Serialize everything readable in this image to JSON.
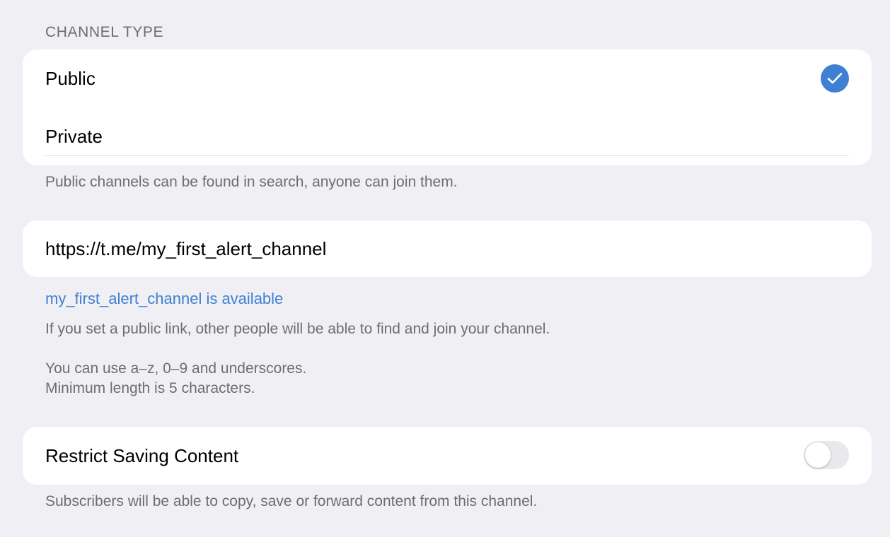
{
  "channel_type": {
    "header": "CHANNEL TYPE",
    "options": [
      {
        "label": "Public",
        "selected": true
      },
      {
        "label": "Private",
        "selected": false
      }
    ],
    "footer": "Public channels can be found in search, anyone can join them."
  },
  "link": {
    "value": "https://t.me/my_first_alert_channel",
    "availability": "my_first_alert_channel is available",
    "footer_line1": "If you set a public link, other people will be able to find and join your channel.",
    "footer_line2": "You can use a–z, 0–9 and underscores.",
    "footer_line3": "Minimum length is 5 characters."
  },
  "restrict": {
    "label": "Restrict Saving Content",
    "enabled": false,
    "footer": "Subscribers will be able to copy, save or forward content from this channel."
  },
  "colors": {
    "accent": "#3f80d3",
    "background": "#efeff4",
    "secondary_text": "#6d6d72"
  },
  "icons": {
    "selected": "check-icon"
  }
}
